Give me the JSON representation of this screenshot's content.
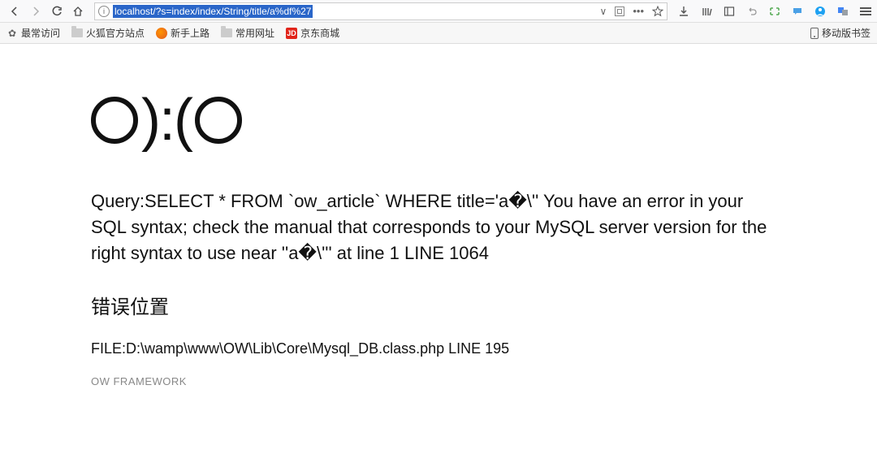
{
  "browser": {
    "url": "localhost/?s=index/index/String/title/a%df%27",
    "bookmarks": {
      "most_visited": "最常访问",
      "firefox_official": "火狐官方站点",
      "newbie": "新手上路",
      "common_sites": "常用网址",
      "jd": "京东商城",
      "jd_icon": "JD",
      "mobile_bookmarks": "移动版书签"
    }
  },
  "page": {
    "face": {
      "left_paren_colon": "):(",
      "alt": "O):(O"
    },
    "query_error": "Query:SELECT * FROM `ow_article` WHERE title='a�\\'' You have an error in your SQL syntax; check the manual that corresponds to your MySQL server version for the right syntax to use near ''a�\\''' at line 1 LINE 1064",
    "error_location_title": "错误位置",
    "file_line": "FILE:D:\\wamp\\www\\OW\\Lib\\Core\\Mysql_DB.class.php LINE 195",
    "framework": "OW FRAMEWORK"
  }
}
